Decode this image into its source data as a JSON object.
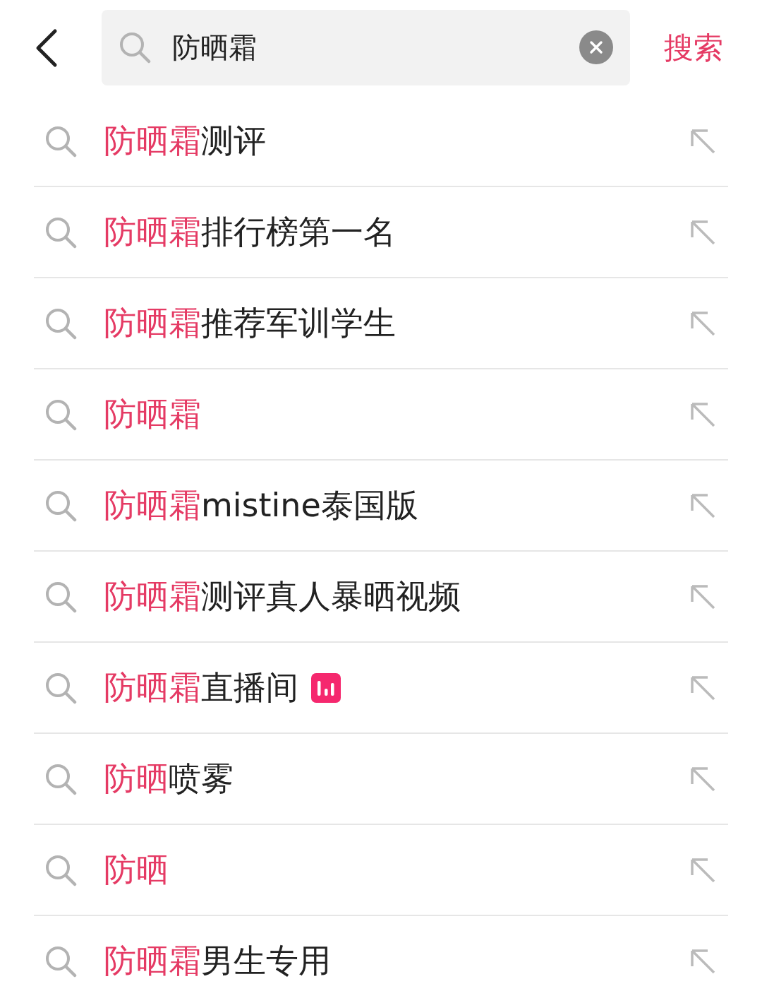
{
  "search_bar": {
    "value": "防晒霜",
    "action": "搜索"
  },
  "suggestions": [
    {
      "match": "防晒霜",
      "rest": "测评",
      "live": false
    },
    {
      "match": "防晒霜",
      "rest": "排行榜第一名",
      "live": false
    },
    {
      "match": "防晒霜",
      "rest": "推荐军训学生",
      "live": false
    },
    {
      "match": "防晒霜",
      "live": false
    },
    {
      "match": "防晒霜",
      "rest": "mistine泰国版",
      "live": false
    },
    {
      "match": "防晒霜",
      "rest": "测评真人暴晒视频",
      "live": false
    },
    {
      "match": "防晒霜",
      "rest": "直播间",
      "live": true
    },
    {
      "match": "防晒",
      "rest": "喷雾",
      "live": false
    },
    {
      "match": "防晒",
      "live": false
    },
    {
      "match": "防晒霜",
      "rest": "男生专用",
      "live": false
    }
  ]
}
